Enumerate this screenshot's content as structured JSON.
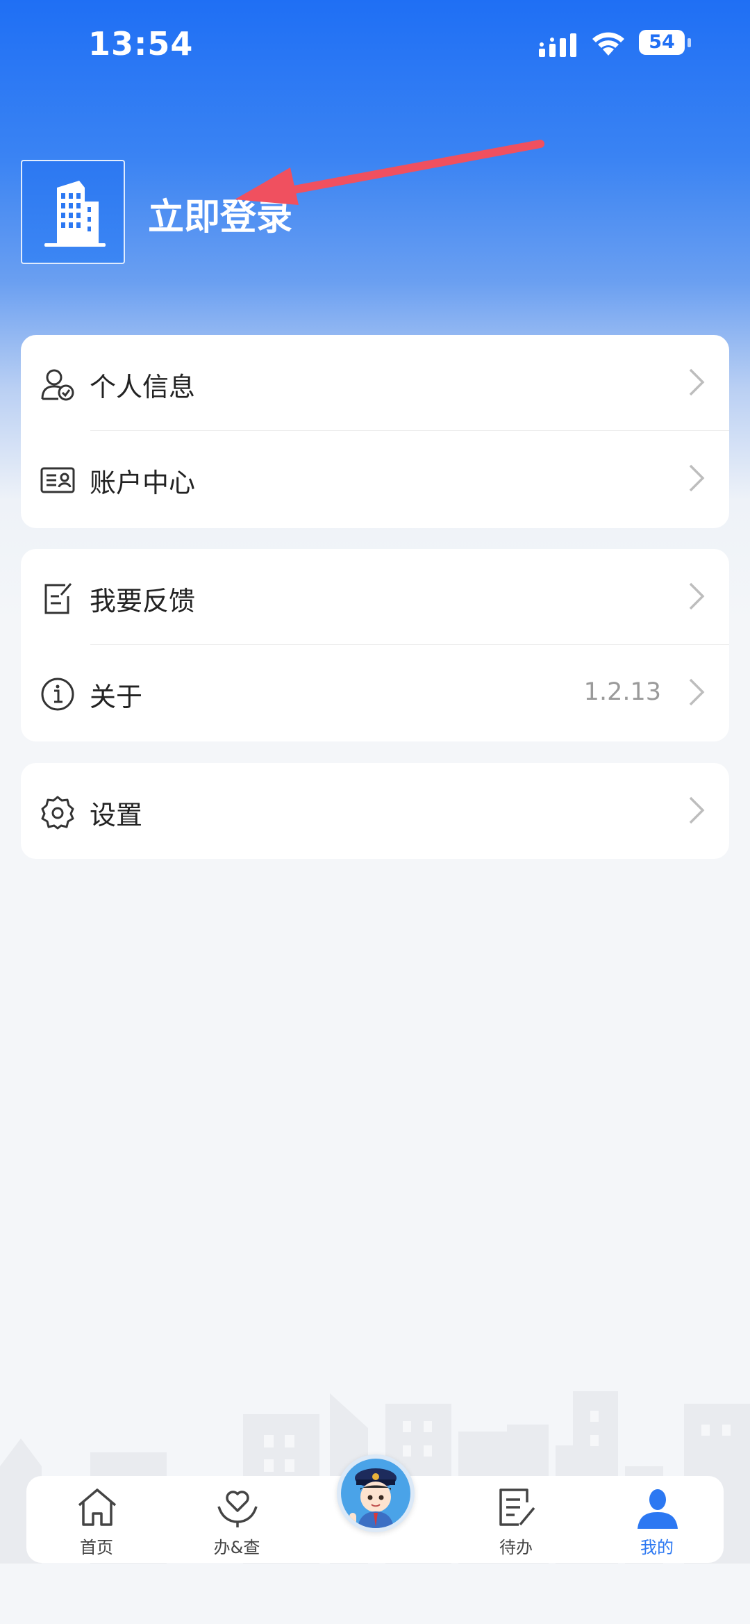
{
  "status_bar": {
    "time": "13:54",
    "battery": "54"
  },
  "header": {
    "login_label": "立即登录"
  },
  "menu": {
    "group1": [
      {
        "label": "个人信息",
        "icon": "user-check-icon"
      },
      {
        "label": "账户中心",
        "icon": "id-card-icon"
      }
    ],
    "group2": [
      {
        "label": "我要反馈",
        "icon": "feedback-edit-icon"
      },
      {
        "label": "关于",
        "icon": "info-icon",
        "value": "1.2.13"
      }
    ],
    "group3": [
      {
        "label": "设置",
        "icon": "settings-gear-icon"
      }
    ]
  },
  "tabbar": {
    "items": [
      {
        "label": "首页",
        "icon": "home-icon"
      },
      {
        "label": "办&查",
        "icon": "heart-hand-icon"
      },
      {
        "label": "",
        "icon": "assistant-avatar-icon"
      },
      {
        "label": "待办",
        "icon": "todo-list-icon"
      },
      {
        "label": "我的",
        "icon": "profile-icon",
        "active": true
      }
    ]
  },
  "colors": {
    "accent": "#2c78f2",
    "annotation_arrow": "#f0505f"
  }
}
